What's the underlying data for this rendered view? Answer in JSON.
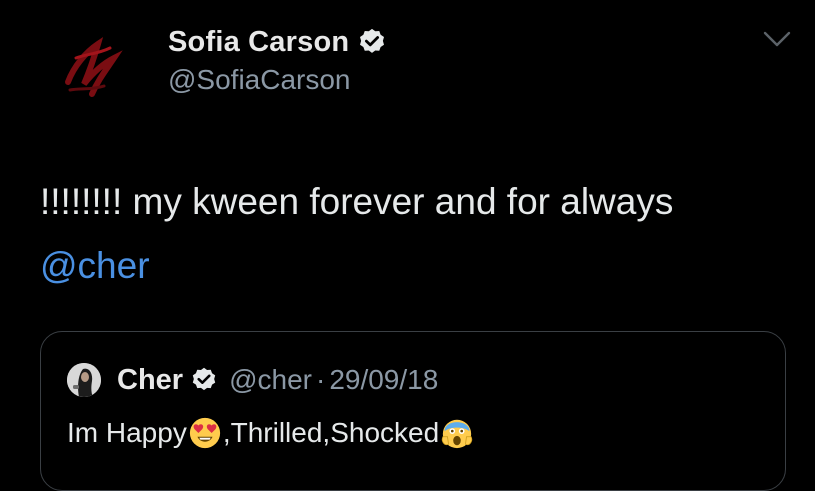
{
  "author": {
    "name": "Sofia Carson",
    "handle": "@SofiaCarson"
  },
  "tweet": {
    "text": "!!!!!!!! my kween forever and for always",
    "mention": "@cher"
  },
  "quoted_tweet": {
    "name": "Cher",
    "handle": "@cher",
    "separator": "·",
    "date": "29/09/18",
    "text_part1": "Im Happy",
    "text_part2": ",Thrilled,Shocked"
  },
  "icons": {
    "verified": "verified-badge-icon",
    "caret": "chevron-down-icon",
    "emoji_1": "heart-eyes-emoji",
    "emoji_2": "screaming-face-emoji"
  },
  "colors": {
    "background": "#000000",
    "text": "#e6e9ea",
    "secondary_text": "#8b98a5",
    "link": "#4a90e2",
    "card_border": "#3a3f44"
  }
}
